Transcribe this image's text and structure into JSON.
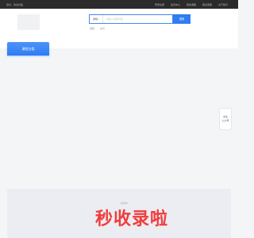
{
  "topbar": {
    "greeting": "您好，欢迎光临",
    "links": [
      "登录注册",
      "会员中心",
      "我的课程",
      "联系客服",
      "关于我们"
    ]
  },
  "search": {
    "type_label": "课程",
    "placeholder": "请输入搜索内容",
    "button_label": "搜索",
    "hot_words": [
      "课程",
      "资讯"
    ]
  },
  "nav": {
    "category_label": "课程分类"
  },
  "side_float": {
    "line1": "关注",
    "line2": "公众号"
  },
  "footer": {
    "text": "加载中..."
  },
  "watermark": {
    "text": "秒收录啦"
  },
  "colors": {
    "accent": "#2f7cf5",
    "topbar": "#2b2b2b",
    "watermark": "#f33b3b"
  }
}
